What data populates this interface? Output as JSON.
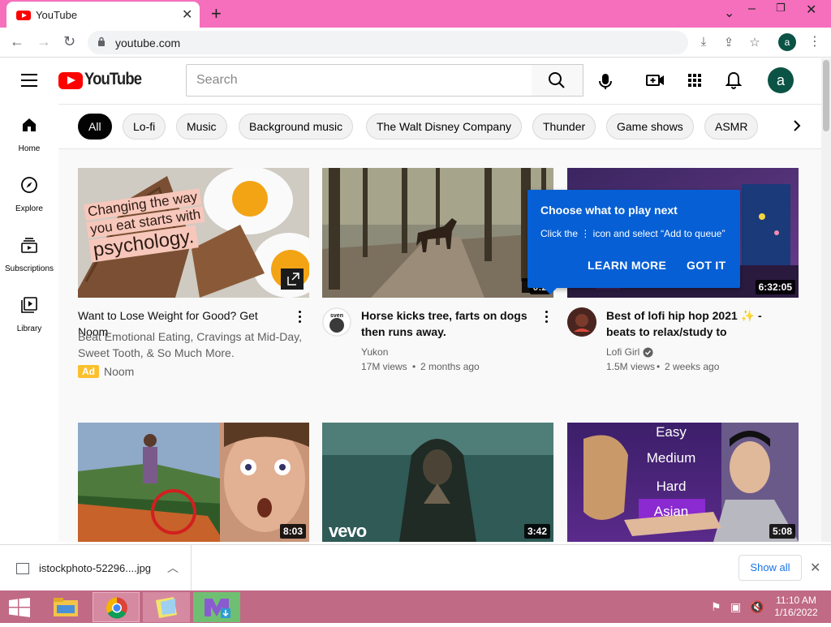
{
  "browser": {
    "tab_title": "YouTube",
    "url": "youtube.com",
    "profile_initial": "a"
  },
  "header": {
    "logo_text": "YouTube",
    "search_placeholder": "Search",
    "avatar_initial": "a"
  },
  "guide": {
    "items": [
      {
        "label": "Home",
        "icon": "home-icon"
      },
      {
        "label": "Explore",
        "icon": "compass-icon"
      },
      {
        "label": "Subscriptions",
        "icon": "subscriptions-icon"
      },
      {
        "label": "Library",
        "icon": "library-icon"
      }
    ]
  },
  "chips": [
    "All",
    "Lo-fi",
    "Music",
    "Background music",
    "The Walt Disney Company",
    "Thunder",
    "Game shows",
    "ASMR"
  ],
  "videos": [
    {
      "title": "Want to Lose Weight for Good? Get Noom",
      "description": "Beat Emotional Eating, Cravings at Mid-Day, Sweet Tooth, & So Much More.",
      "ad_badge": "Ad",
      "advertiser": "Noom",
      "thumb_text": [
        "Changing the way",
        "you eat starts with",
        "psychology."
      ]
    },
    {
      "title": "Horse kicks tree, farts on dogs then runs away.",
      "channel": "Yukon",
      "views": "17M views",
      "age": "2 months ago",
      "duration": "0:2"
    },
    {
      "title": "Best of lofi hip hop 2021 ✨ - beats to relax/study to",
      "channel": "Lofi Girl",
      "views": "1.5M views",
      "age": "2 weeks ago",
      "duration": "6:32:05"
    },
    {
      "duration": "8:03"
    },
    {
      "duration": "3:42",
      "watermark": "vevo"
    },
    {
      "duration": "5:08",
      "thumb_levels": [
        "Easy",
        "Medium",
        "Hard",
        "Asian"
      ]
    }
  ],
  "tooltip": {
    "title": "Choose what to play next",
    "body": "Click the ⋮ icon and select “Add to queue”",
    "learn_more": "LEARN MORE",
    "got_it": "GOT IT"
  },
  "download": {
    "filename": "istockphoto-52296....jpg",
    "show_all": "Show all"
  },
  "taskbar": {
    "time": "11:10 AM",
    "date": "1/16/2022"
  },
  "colors": {
    "tabbar": "#f56fbd",
    "yt_red": "#ff0000",
    "tooltip_blue": "#065fd4",
    "taskbar": "#c06a86",
    "avatar": "#0b5345"
  }
}
